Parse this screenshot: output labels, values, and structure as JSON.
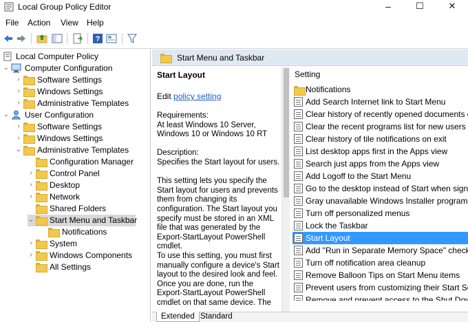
{
  "window": {
    "title": "Local Group Policy Editor",
    "minimize": "–",
    "maximize": "☐",
    "close": "✕"
  },
  "menu": [
    "File",
    "Action",
    "View",
    "Help"
  ],
  "toolbar": [
    "back-icon",
    "forward-icon",
    "up-folder-icon",
    "show-hide-tree-icon",
    "export-list-icon",
    "help-icon",
    "properties-icon",
    "filter-icon"
  ],
  "colors": {
    "selection": "#3399ff",
    "header": "#dfe8f3",
    "folder": "#f2c94c",
    "link": "#1a5cc8"
  },
  "tree": [
    {
      "label": "Local Computer Policy",
      "expander": "",
      "icon": "computer-policy-icon"
    },
    {
      "label": "Computer Configuration",
      "expander": "⌄",
      "icon": "computer-icon"
    },
    {
      "label": "Software Settings",
      "expander": "›",
      "icon": "folder-icon"
    },
    {
      "label": "Windows Settings",
      "expander": "›",
      "icon": "folder-icon"
    },
    {
      "label": "Administrative Templates",
      "expander": "›",
      "icon": "folder-icon"
    },
    {
      "label": "User Configuration",
      "expander": "⌄",
      "icon": "user-icon"
    },
    {
      "label": "Software Settings",
      "expander": "›",
      "icon": "folder-icon"
    },
    {
      "label": "Windows Settings",
      "expander": "›",
      "icon": "folder-icon"
    },
    {
      "label": "Administrative Templates",
      "expander": "⌄",
      "icon": "folder-icon"
    },
    {
      "label": "Configuration Manager",
      "expander": "",
      "icon": "folder-icon"
    },
    {
      "label": "Control Panel",
      "expander": "›",
      "icon": "folder-icon"
    },
    {
      "label": "Desktop",
      "expander": "›",
      "icon": "folder-icon"
    },
    {
      "label": "Network",
      "expander": "›",
      "icon": "folder-icon"
    },
    {
      "label": "Shared Folders",
      "expander": "",
      "icon": "folder-icon"
    },
    {
      "label": "Start Menu and Taskbar",
      "expander": "⌄",
      "icon": "folder-icon",
      "selected": true
    },
    {
      "label": "Notifications",
      "expander": "",
      "icon": "folder-icon"
    },
    {
      "label": "System",
      "expander": "›",
      "icon": "folder-icon"
    },
    {
      "label": "Windows Components",
      "expander": "›",
      "icon": "folder-icon"
    },
    {
      "label": "All Settings",
      "expander": "",
      "icon": "folder-icon"
    }
  ],
  "right_header": {
    "title": "Start Menu and Taskbar"
  },
  "description": {
    "title": "Start Layout",
    "edit_prefix": "Edit ",
    "edit_link": "policy setting",
    "requirements_label": "Requirements:",
    "requirements": "At least Windows 10 Server, Windows 10 or Windows 10 RT",
    "description_label": "Description:",
    "description": "Specifies the Start layout for users.",
    "para1": "This setting lets you specify the Start layout for users and prevents them from changing its configuration. The Start layout you specify must be stored in an XML file that was generated by the Export-StartLayout PowerShell cmdlet.",
    "para2": "To use this setting, you must first manually configure a device's Start layout to the desired look and feel. Once you are done, run the Export-StartLayout PowerShell cmdlet on that same device. The"
  },
  "settings": {
    "column_header": "Setting",
    "items": [
      {
        "label": "Notifications",
        "icon": "folder-icon"
      },
      {
        "label": "Add Search Internet link to Start Menu",
        "icon": "policy-icon"
      },
      {
        "label": "Clear history of recently opened documents on exit",
        "icon": "policy-icon"
      },
      {
        "label": "Clear the recent programs list for new users",
        "icon": "policy-icon"
      },
      {
        "label": "Clear history of tile notifications on exit",
        "icon": "policy-icon"
      },
      {
        "label": "List desktop apps first in the Apps view",
        "icon": "policy-icon"
      },
      {
        "label": "Search just apps from the Apps view",
        "icon": "policy-icon"
      },
      {
        "label": "Add Logoff to the Start Menu",
        "icon": "policy-icon"
      },
      {
        "label": "Go to the desktop instead of Start when signing in",
        "icon": "policy-icon"
      },
      {
        "label": "Gray unavailable Windows Installer programs Start",
        "icon": "policy-icon"
      },
      {
        "label": "Turn off personalized menus",
        "icon": "policy-icon"
      },
      {
        "label": "Lock the Taskbar",
        "icon": "policy-icon"
      },
      {
        "label": "Start Layout",
        "icon": "policy-icon",
        "selected": true
      },
      {
        "label": "Add \"Run in Separate Memory Space\" check box",
        "icon": "policy-icon"
      },
      {
        "label": "Turn off notification area cleanup",
        "icon": "policy-icon"
      },
      {
        "label": "Remove Balloon Tips on Start Menu items",
        "icon": "policy-icon"
      },
      {
        "label": "Prevent users from customizing their Start Screen",
        "icon": "policy-icon"
      },
      {
        "label": "Remove and prevent access to the Shut Down, Re",
        "icon": "policy-icon"
      }
    ]
  },
  "tabs": [
    {
      "label": "Extended",
      "active": true
    },
    {
      "label": "Standard",
      "active": false
    }
  ]
}
